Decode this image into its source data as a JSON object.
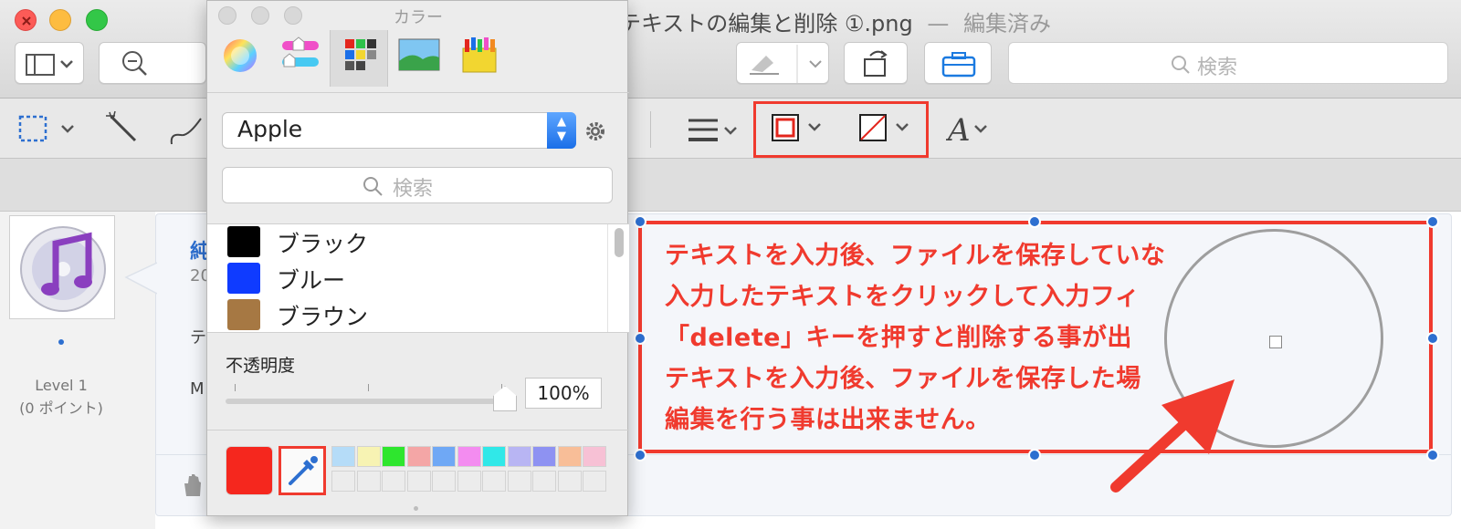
{
  "window": {
    "title": "テキストの編集と削除 ①.png",
    "title_separator": "—",
    "title_state": "編集済み",
    "search_placeholder": "検索"
  },
  "colors": {
    "accent_red": "#f03a2e",
    "handle_blue": "#2d6fd0",
    "current_color": "#f5271e"
  },
  "annotation": {
    "text": "テキストを入力後、ファイルを保存していな         たら\n入力したテキストをクリックして入力フィ              せ、\n「delete」キーを押すと削除する事が出\nテキストを入力後、ファイルを保存した場               の\n編集を行う事は出来ません。"
  },
  "sidebar": {
    "level": "Level 1",
    "points": "(0 ポイント)"
  },
  "card": {
    "title_fragment": "純",
    "date_fragment": "20",
    "line1": "テ",
    "line2": "M"
  },
  "color_panel": {
    "title": "カラー",
    "palette_name": "Apple",
    "search_placeholder": "検索",
    "colors": [
      {
        "name": "ブラック",
        "hex": "#000000"
      },
      {
        "name": "ブルー",
        "hex": "#0f3bff"
      },
      {
        "name": "ブラウン",
        "hex": "#a67843"
      }
    ],
    "opacity_label": "不透明度",
    "opacity_value": "100%",
    "opacity_fraction": 1.0,
    "swatches": [
      "#b5dcf8",
      "#f7f3b3",
      "#2ee62e",
      "#f4a6a6",
      "#6fa8f5",
      "#f38cf0",
      "#30e8e8",
      "#b8b5f3",
      "#8e92f2",
      "#f8be98",
      "#f7c1d5"
    ]
  }
}
